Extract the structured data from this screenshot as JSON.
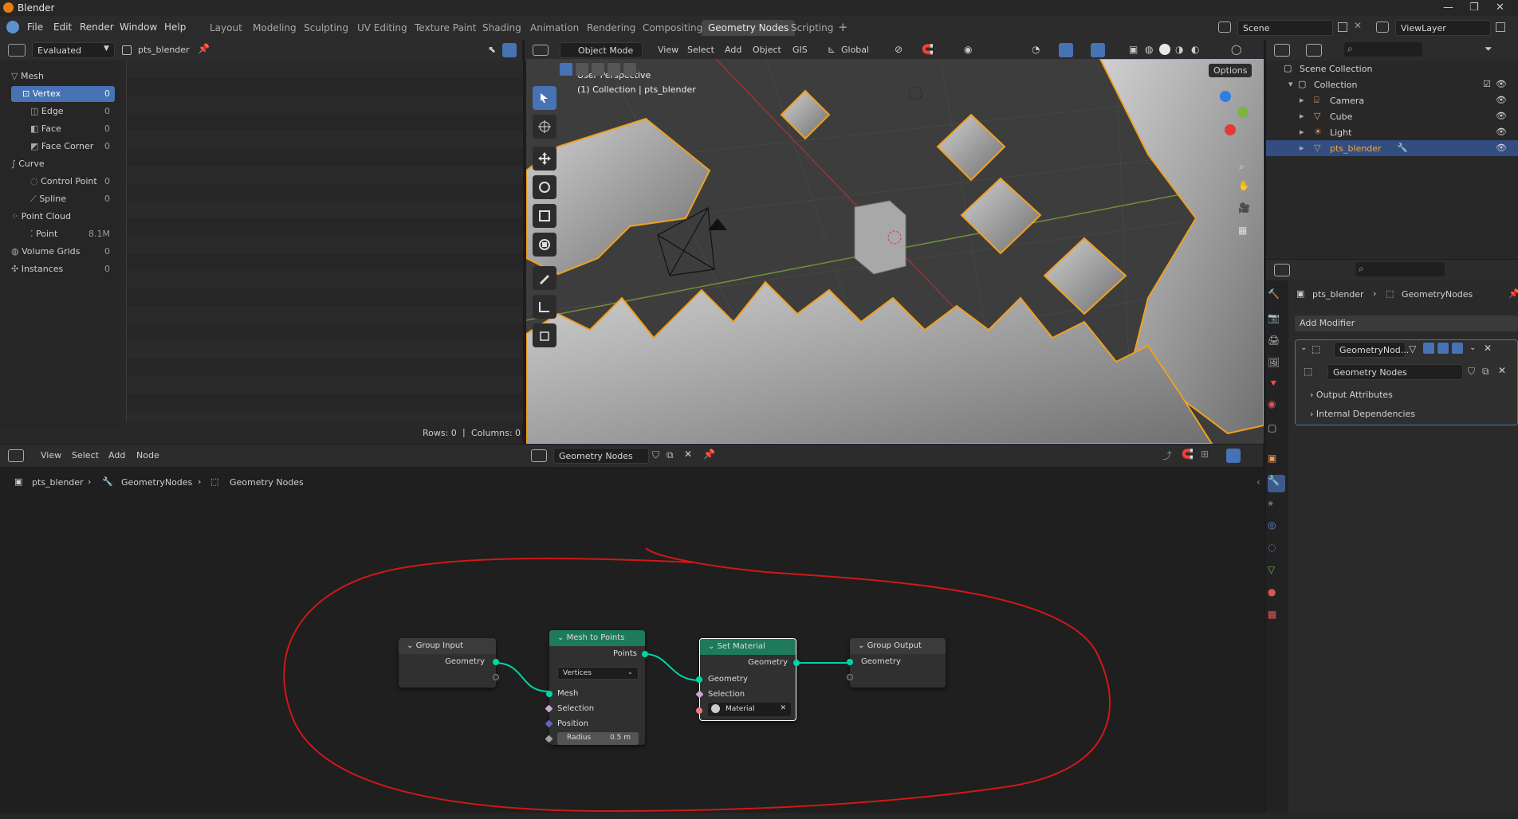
{
  "app": {
    "title": "Blender"
  },
  "menu": [
    "File",
    "Edit",
    "Render",
    "Window",
    "Help"
  ],
  "workspaces": [
    "Layout",
    "Modeling",
    "Sculpting",
    "UV Editing",
    "Texture Paint",
    "Shading",
    "Animation",
    "Rendering",
    "Compositing",
    "Geometry Nodes",
    "Scripting"
  ],
  "active_workspace": "Geometry Nodes",
  "scene_field": "Scene",
  "viewlayer_field": "ViewLayer",
  "spreadsheet": {
    "evaluated": "Evaluated",
    "object": "pts_blender",
    "items": [
      {
        "label": "Mesh",
        "count": "",
        "level": 0
      },
      {
        "label": "Vertex",
        "count": "0",
        "level": 1,
        "selected": true
      },
      {
        "label": "Edge",
        "count": "0",
        "level": 1
      },
      {
        "label": "Face",
        "count": "0",
        "level": 1
      },
      {
        "label": "Face Corner",
        "count": "0",
        "level": 1
      },
      {
        "label": "Curve",
        "count": "",
        "level": 0
      },
      {
        "label": "Control Point",
        "count": "0",
        "level": 1
      },
      {
        "label": "Spline",
        "count": "0",
        "level": 1
      },
      {
        "label": "Point Cloud",
        "count": "",
        "level": 0
      },
      {
        "label": "Point",
        "count": "8.1M",
        "level": 1
      },
      {
        "label": "Volume Grids",
        "count": "0",
        "level": 0
      },
      {
        "label": "Instances",
        "count": "0",
        "level": 0
      }
    ],
    "rows_text": "Rows: 0",
    "columns_text": "Columns: 0"
  },
  "viewport": {
    "mode": "Object Mode",
    "menus": [
      "View",
      "Select",
      "Add",
      "Object",
      "GIS"
    ],
    "orientation": "Global",
    "perspective": "User Perspective",
    "collection_info": "(1) Collection | pts_blender",
    "options": "Options"
  },
  "outliner": {
    "root": "Scene Collection",
    "collection": "Collection",
    "items": [
      {
        "label": "Camera",
        "selected": false
      },
      {
        "label": "Cube",
        "selected": false
      },
      {
        "label": "Light",
        "selected": false
      },
      {
        "label": "pts_blender",
        "selected": true
      }
    ]
  },
  "properties": {
    "object": "pts_blender",
    "modifier_path": "GeometryNodes",
    "add_modifier": "Add Modifier",
    "modifier_name": "GeometryNod...",
    "node_group": "Geometry Nodes",
    "sections": [
      "Output Attributes",
      "Internal Dependencies"
    ]
  },
  "node_editor": {
    "menus": [
      "View",
      "Select",
      "Add",
      "Node"
    ],
    "group_field": "Geometry Nodes",
    "breadcrumb": [
      "pts_blender",
      "GeometryNodes",
      "Geometry Nodes"
    ],
    "nodes": {
      "group_input": {
        "title": "Group Input",
        "out": "Geometry"
      },
      "mesh_to_points": {
        "title": "Mesh to Points",
        "out": "Points",
        "mode": "Vertices",
        "inputs": [
          "Mesh",
          "Selection",
          "Position"
        ],
        "radius_label": "Radius",
        "radius_value": "0.5 m"
      },
      "set_material": {
        "title": "Set Material",
        "out": "Geometry",
        "inputs": [
          "Geometry",
          "Selection"
        ],
        "material": "Material"
      },
      "group_output": {
        "title": "Group Output",
        "in": "Geometry"
      }
    }
  },
  "colors": {
    "accent": "#4772b3",
    "selection_orange": "#f0a020",
    "geo_socket": "#00d6a3",
    "node_header_green": "#1e7a5a",
    "annotation": "#d01818"
  }
}
